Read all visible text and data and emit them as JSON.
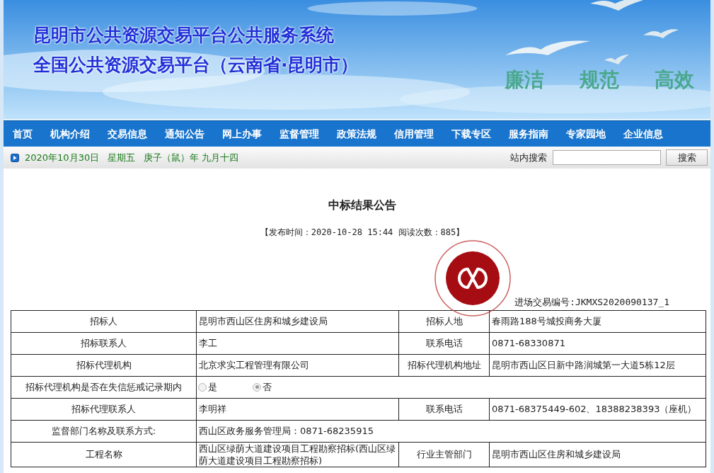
{
  "banner": {
    "title": "昆明市公共资源交易平台公共服务系统",
    "subtitle": "全国公共资源交易平台（云南省·昆明市）",
    "slogans": [
      "廉洁",
      "规范",
      "高效"
    ]
  },
  "nav": [
    "首页",
    "机构介绍",
    "交易信息",
    "通知公告",
    "网上办事",
    "监督管理",
    "政策法规",
    "信用管理",
    "下载专区",
    "服务指南",
    "专家园地",
    "企业信息"
  ],
  "datebar": {
    "date": "2020年10月30日",
    "weekday": "星期五",
    "lunar": "庚子（鼠）年 九月十四",
    "search_label": "站内搜索",
    "search_button": "搜索"
  },
  "article": {
    "title": "中标结果公告",
    "meta": "【发布时间：2020-10-28 15:44 阅读次数：885】",
    "number": "进场交易编号:JKMXS2020090137_1",
    "rows": [
      {
        "kind": "pair",
        "cells": [
          "招标人",
          "昆明市西山区住房和城乡建设局",
          "招标人地",
          "春雨路188号城投商务大厦"
        ]
      },
      {
        "kind": "pair",
        "cells": [
          "招标联系人",
          "李工",
          "联系电话",
          "0871-68330871"
        ]
      },
      {
        "kind": "pair",
        "cells": [
          "招标代理机构",
          "北京求实工程管理有限公司",
          "招标代理机构地址",
          "昆明市西山区日新中路润城第一大道5栋12层"
        ]
      },
      {
        "kind": "radio",
        "label": "招标代理机构是否在失信惩戒记录期内",
        "options": [
          {
            "label": "是",
            "selected": false
          },
          {
            "label": "否",
            "selected": true
          }
        ]
      },
      {
        "kind": "pair",
        "cells": [
          "招标代理联系人",
          "李明祥",
          "联系电话",
          "0871-68375449-602、18388238393（座机）"
        ]
      },
      {
        "kind": "single",
        "cells": [
          "监督部门名称及联系方式:",
          "西山区政务服务管理局：0871-68235915"
        ]
      },
      {
        "kind": "pair",
        "cells": [
          "工程名称",
          "西山区绿荫大道建设项目工程勘察招标(西山区绿荫大道建设项目工程勘察招标)",
          "行业主管部门",
          "昆明市西山区住房和城乡建设局"
        ]
      }
    ]
  }
}
